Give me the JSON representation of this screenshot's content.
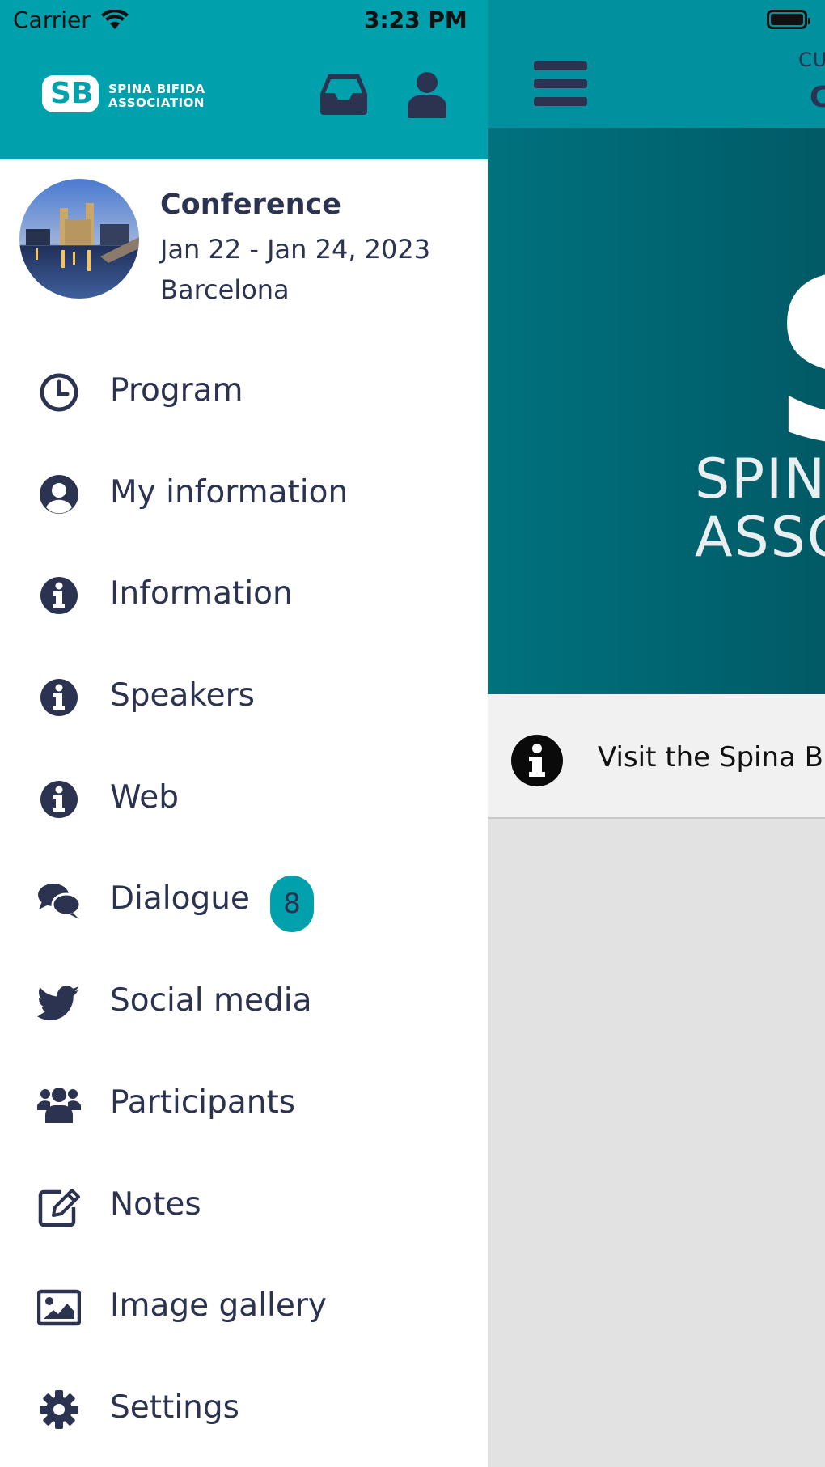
{
  "status_bar": {
    "carrier": "Carrier",
    "time": "3:23 PM"
  },
  "colors": {
    "brand": "#00a0ac",
    "dark": "#2c3350",
    "badge": "#00a0ac"
  },
  "drawer": {
    "logo": {
      "line1": "SPINA BIFIDA",
      "line2": "ASSOCIATION",
      "mark": "SB"
    },
    "header_icons": [
      "inbox-icon",
      "user-icon"
    ],
    "event": {
      "title": "Conference",
      "dates": "Jan 22 - Jan 24, 2023",
      "location": "Barcelona"
    },
    "menu": [
      {
        "label": "Program",
        "icon": "clock-icon"
      },
      {
        "label": "My information",
        "icon": "user-circle-icon"
      },
      {
        "label": "Information",
        "icon": "info-icon"
      },
      {
        "label": "Speakers",
        "icon": "info-icon"
      },
      {
        "label": "Web",
        "icon": "info-icon"
      },
      {
        "label": "Dialogue",
        "icon": "chat-icon",
        "badge": "8"
      },
      {
        "label": "Social media",
        "icon": "twitter-icon"
      },
      {
        "label": "Participants",
        "icon": "users-icon"
      },
      {
        "label": "Notes",
        "icon": "edit-icon"
      },
      {
        "label": "Image gallery",
        "icon": "image-icon"
      },
      {
        "label": "Settings",
        "icon": "gear-icon"
      }
    ]
  },
  "main": {
    "header_sub": "CU",
    "header_title": "C",
    "banner": {
      "letter": "S",
      "line1": "SPIN",
      "line2": "ASSO"
    },
    "notice_text": "Visit the Spina Bif"
  }
}
